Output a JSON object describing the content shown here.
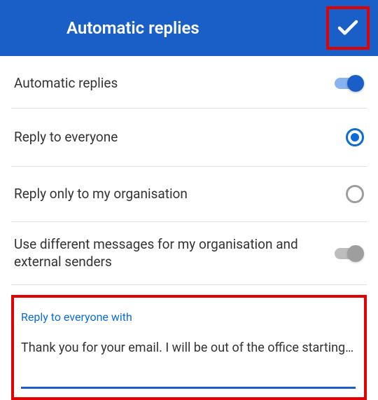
{
  "header": {
    "title": "Automatic replies"
  },
  "settings": {
    "autoReplies": {
      "label": "Automatic replies",
      "enabled": true
    },
    "replyEveryone": {
      "label": "Reply to everyone",
      "selected": true
    },
    "replyOrg": {
      "label": "Reply only to my organisation",
      "selected": false
    },
    "differentMessages": {
      "label": "Use different messages for my organisation and external senders",
      "enabled": false
    }
  },
  "message": {
    "label": "Reply to everyone with",
    "text": "Thank you for your email. I will be out of the office starting…"
  }
}
